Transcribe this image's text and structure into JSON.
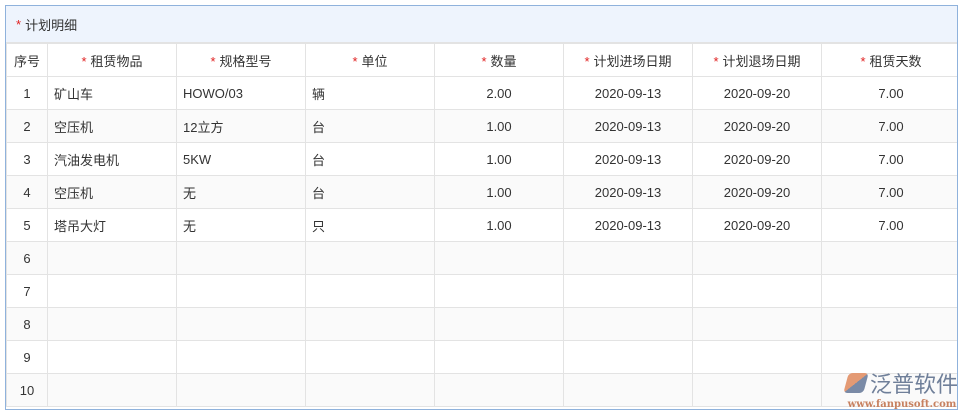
{
  "section_title": "计划明细",
  "required_mark": "*",
  "columns": [
    {
      "label": "序号",
      "required": false
    },
    {
      "label": "租赁物品",
      "required": true
    },
    {
      "label": "规格型号",
      "required": true
    },
    {
      "label": "单位",
      "required": true
    },
    {
      "label": "数量",
      "required": true
    },
    {
      "label": "计划进场日期",
      "required": true
    },
    {
      "label": "计划退场日期",
      "required": true
    },
    {
      "label": "租赁天数",
      "required": true
    }
  ],
  "rows": [
    [
      "1",
      "矿山车",
      "HOWO/03",
      "辆",
      "2.00",
      "2020-09-13",
      "2020-09-20",
      "7.00"
    ],
    [
      "2",
      "空压机",
      "12立方",
      "台",
      "1.00",
      "2020-09-13",
      "2020-09-20",
      "7.00"
    ],
    [
      "3",
      "汽油发电机",
      "5KW",
      "台",
      "1.00",
      "2020-09-13",
      "2020-09-20",
      "7.00"
    ],
    [
      "4",
      "空压机",
      "无",
      "台",
      "1.00",
      "2020-09-13",
      "2020-09-20",
      "7.00"
    ],
    [
      "5",
      "塔吊大灯",
      "无",
      "只",
      "1.00",
      "2020-09-13",
      "2020-09-20",
      "7.00"
    ],
    [
      "6",
      "",
      "",
      "",
      "",
      "",
      "",
      ""
    ],
    [
      "7",
      "",
      "",
      "",
      "",
      "",
      "",
      ""
    ],
    [
      "8",
      "",
      "",
      "",
      "",
      "",
      "",
      ""
    ],
    [
      "9",
      "",
      "",
      "",
      "",
      "",
      "",
      ""
    ],
    [
      "10",
      "",
      "",
      "",
      "",
      "",
      "",
      ""
    ]
  ],
  "logo": {
    "name": "泛普软件",
    "url": "www.fanpusoft.com"
  }
}
